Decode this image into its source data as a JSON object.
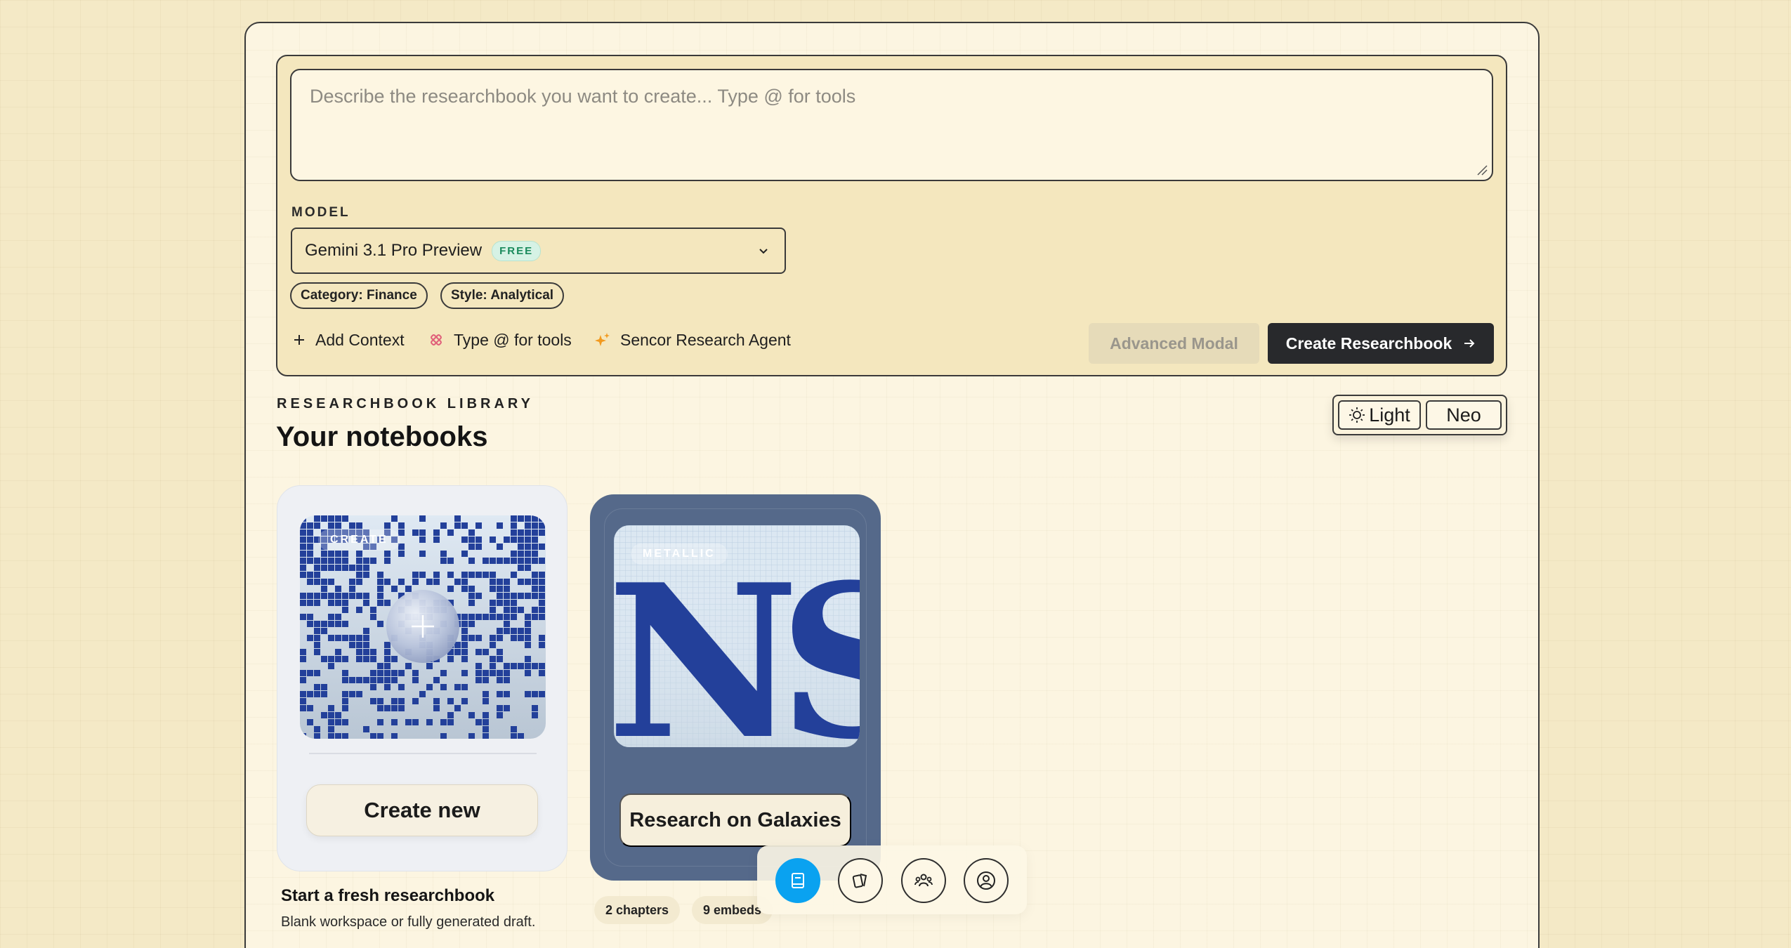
{
  "composer": {
    "placeholder": "Describe the researchbook you want to create... Type @ for tools",
    "model_label": "MODEL",
    "model_name": "Gemini 3.1 Pro Preview",
    "model_badge": "FREE",
    "chips": [
      "Category: Finance",
      "Style: Analytical"
    ],
    "actions": {
      "add_context": "Add Context",
      "tools": "Type @ for tools",
      "agent": "Sencor Research Agent"
    },
    "advanced_label": "Advanced Modal",
    "create_label": "Create Researchbook"
  },
  "library": {
    "eyebrow": "RESEARCHBOOK LIBRARY",
    "title": "Your notebooks"
  },
  "theme": {
    "light_label": "Light",
    "neo_label": "Neo"
  },
  "cards": {
    "create": {
      "badge": "CREATE",
      "button": "Create new",
      "caption_title": "Start a fresh researchbook",
      "caption_sub": "Blank workspace or fully generated draft."
    },
    "galaxies": {
      "badge": "METALLIC",
      "art_text": "NS",
      "button": "Research on Galaxies",
      "chapters": "2 chapters",
      "embeds": "9 embeds"
    }
  },
  "dock": {
    "items": [
      "notebook-icon",
      "cards-icon",
      "team-icon",
      "profile-icon"
    ],
    "active_index": 0
  },
  "colors": {
    "accent": "#0aa2f0",
    "primary_button": "#28292c",
    "card_galaxy": "#55698a",
    "art_blue": "#23409a"
  }
}
